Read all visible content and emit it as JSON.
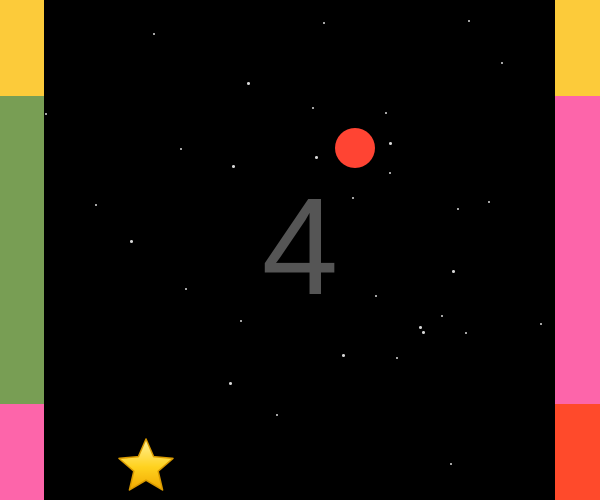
{
  "game": {
    "score": "4",
    "background_color": "#000000",
    "score_color": "#555555",
    "ball": {
      "color": "#ff4433"
    },
    "star_icon": "star-icon",
    "left_wall": {
      "segments": [
        {
          "color": "#fccb3a"
        },
        {
          "color": "#789e54"
        },
        {
          "color": "#fd65aa"
        }
      ]
    },
    "right_wall": {
      "segments": [
        {
          "color": "#fccb3a"
        },
        {
          "color": "#fd65aa"
        },
        {
          "color": "#ff4a2b"
        }
      ]
    }
  }
}
